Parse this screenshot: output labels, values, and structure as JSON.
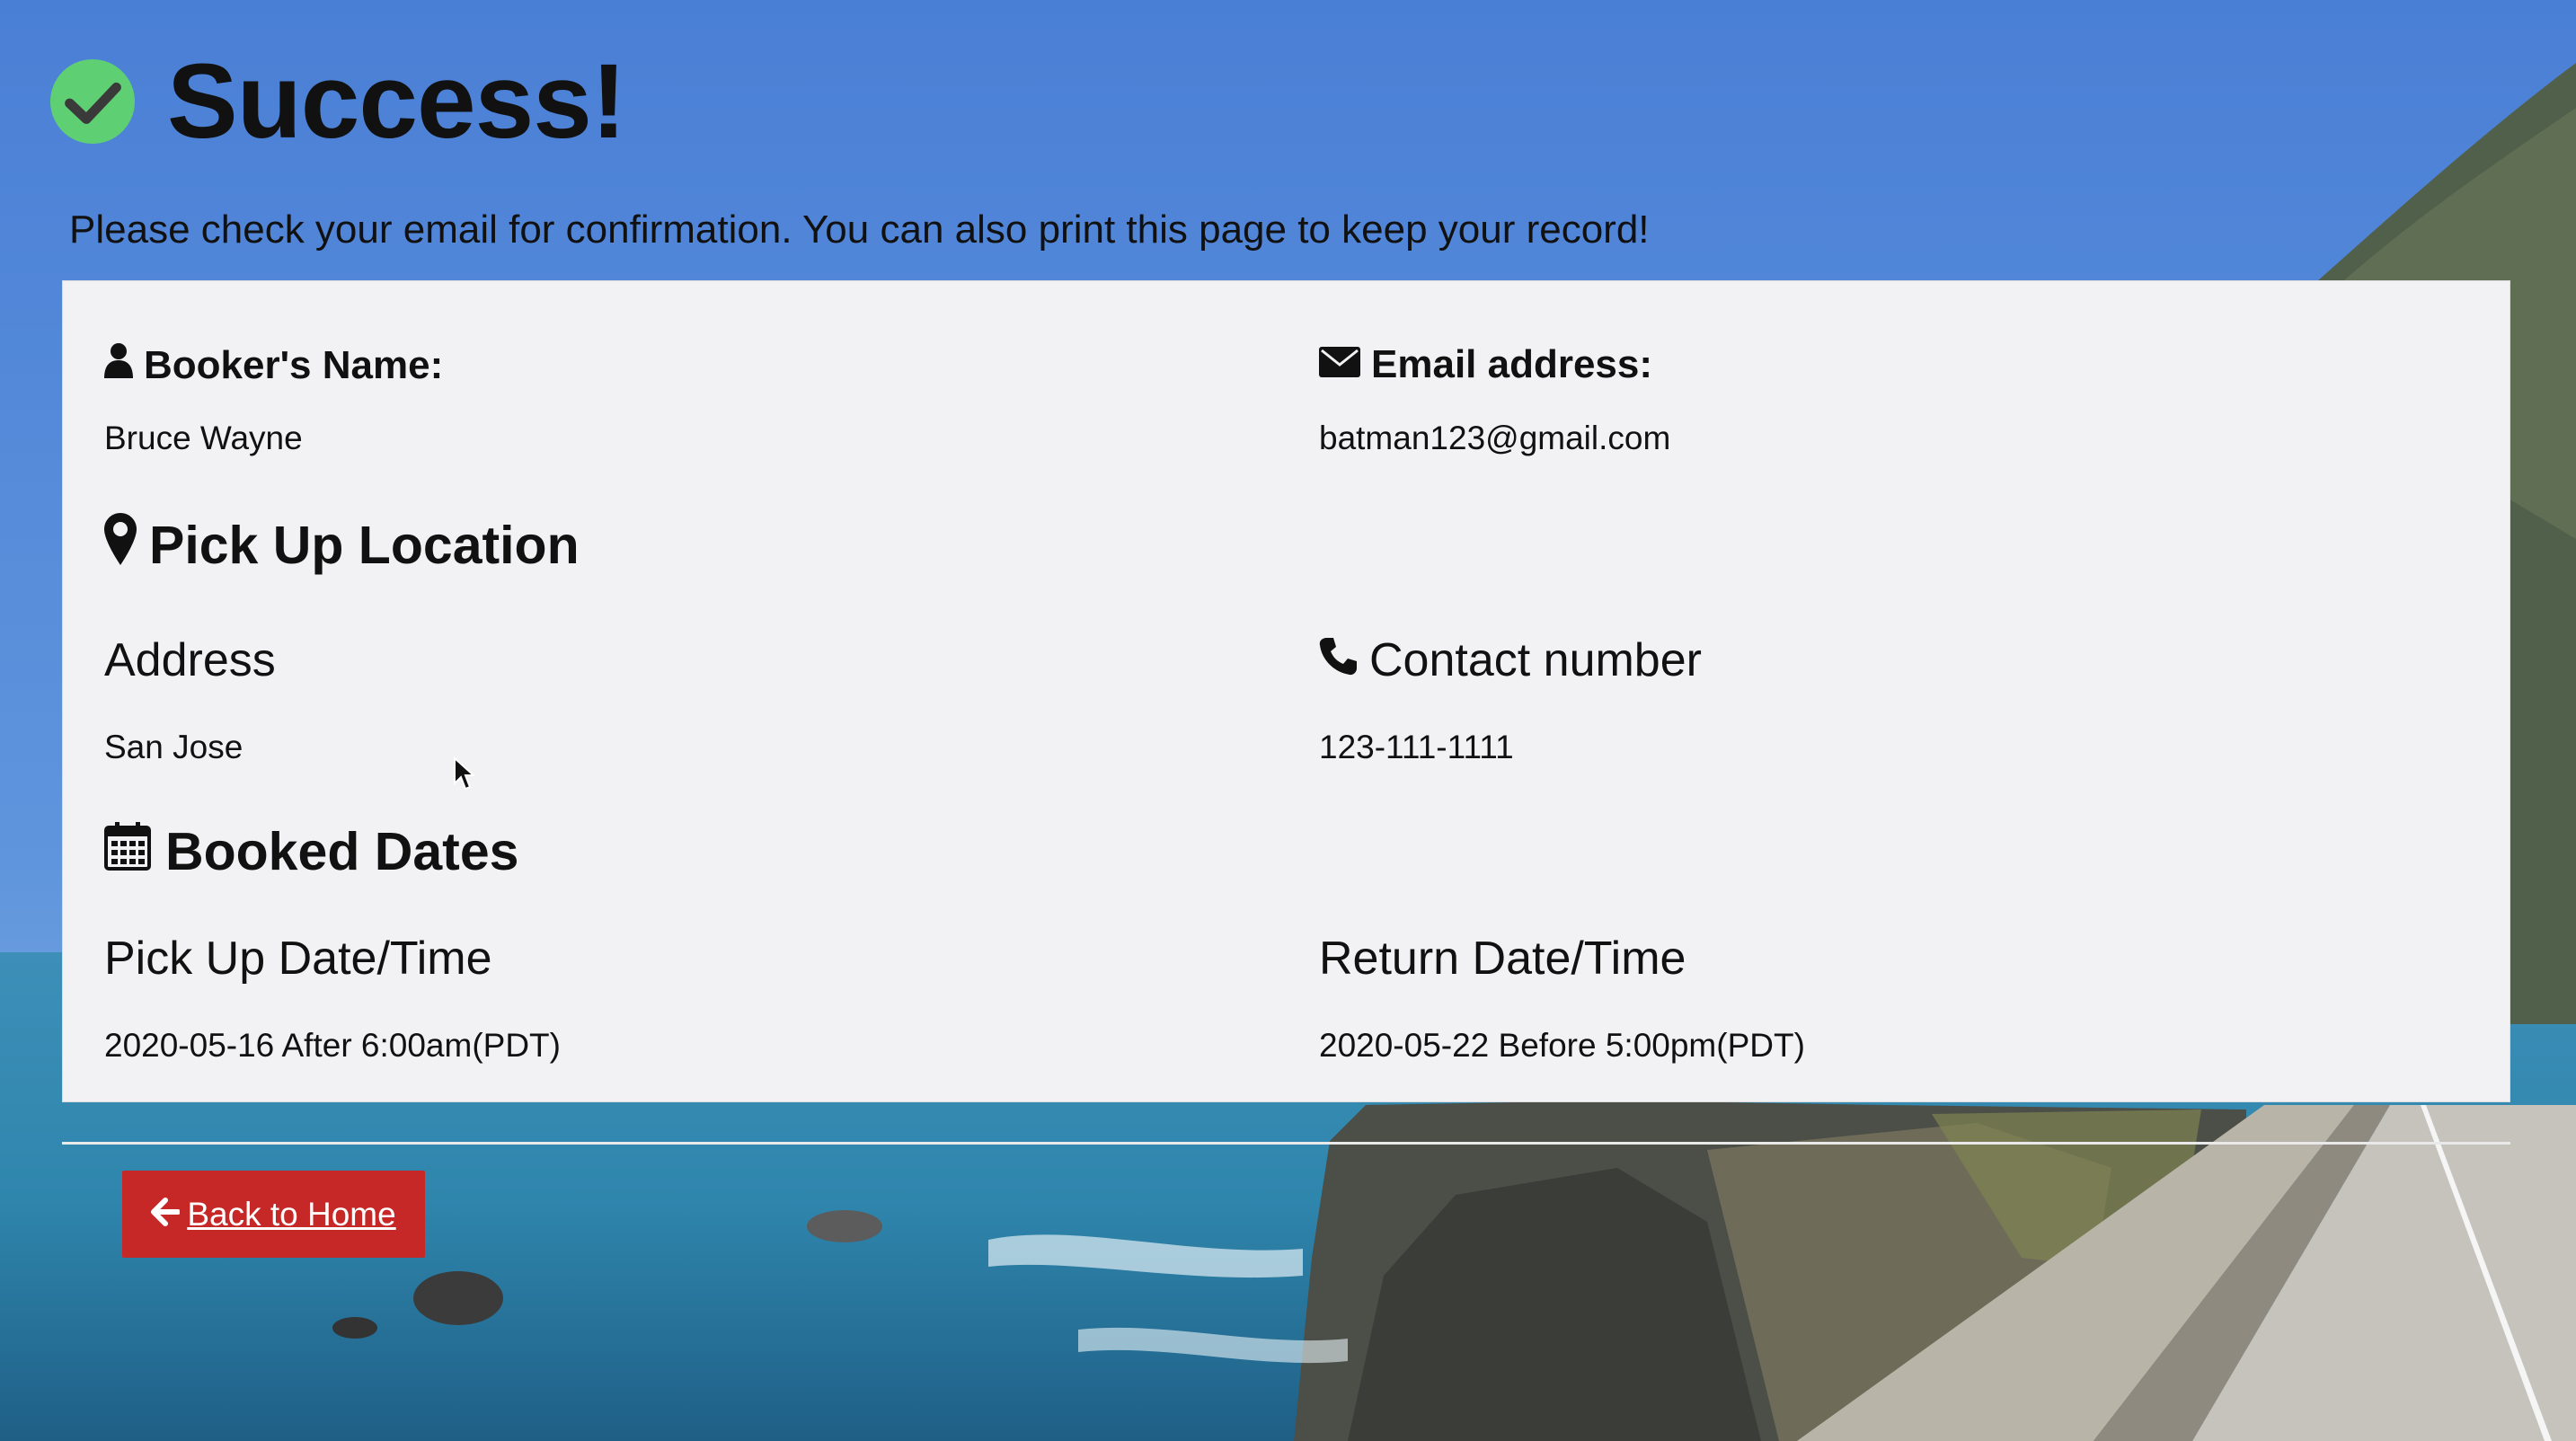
{
  "header": {
    "title": "Success!",
    "check_icon": "check-circle-icon",
    "accent_color": "#5ecf72"
  },
  "message": "Please check your email for confirmation. You can also print this page to keep your record!",
  "booker": {
    "name_label": "Booker's Name:",
    "name_value": "Bruce Wayne",
    "email_label": "Email address:",
    "email_value": "batman123@gmail.com"
  },
  "pickup_location": {
    "title": "Pick Up Location",
    "address_label": "Address",
    "address_value": "San Jose",
    "contact_label": "Contact number",
    "contact_value": "123-111-1111"
  },
  "booked_dates": {
    "title": "Booked Dates",
    "pickup_label": "Pick Up Date/Time",
    "pickup_value": "2020-05-16 After 6:00am(PDT)",
    "return_label": "Return Date/Time",
    "return_value": "2020-05-22 Before 5:00pm(PDT)"
  },
  "actions": {
    "back_label": "Back to Home",
    "back_color": "#c62828"
  }
}
